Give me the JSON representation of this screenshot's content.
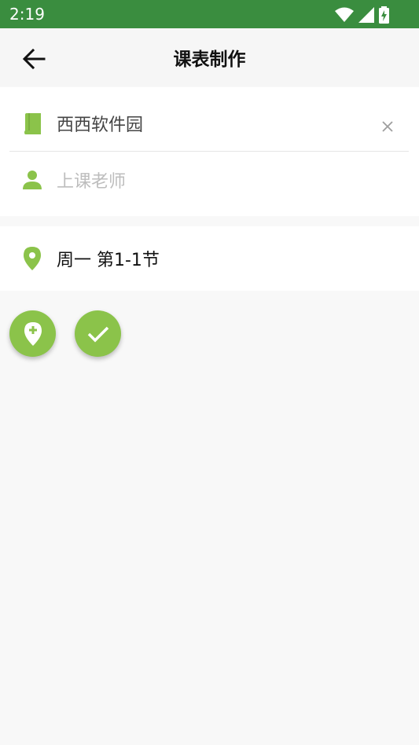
{
  "status_bar": {
    "time": "2:19"
  },
  "app_bar": {
    "title": "课表制作"
  },
  "form": {
    "course_name": "西西软件园",
    "teacher_placeholder": "上课老师"
  },
  "location": {
    "text": "周一 第1-1节"
  },
  "colors": {
    "status_bar": "#3a8d3f",
    "accent": "#8bc34a"
  },
  "icons": {
    "back": "arrow-left-icon",
    "course": "book-icon",
    "teacher": "person-icon",
    "location": "map-pin-icon",
    "clear": "close-icon",
    "add_location": "add-location-icon",
    "confirm": "check-icon"
  }
}
